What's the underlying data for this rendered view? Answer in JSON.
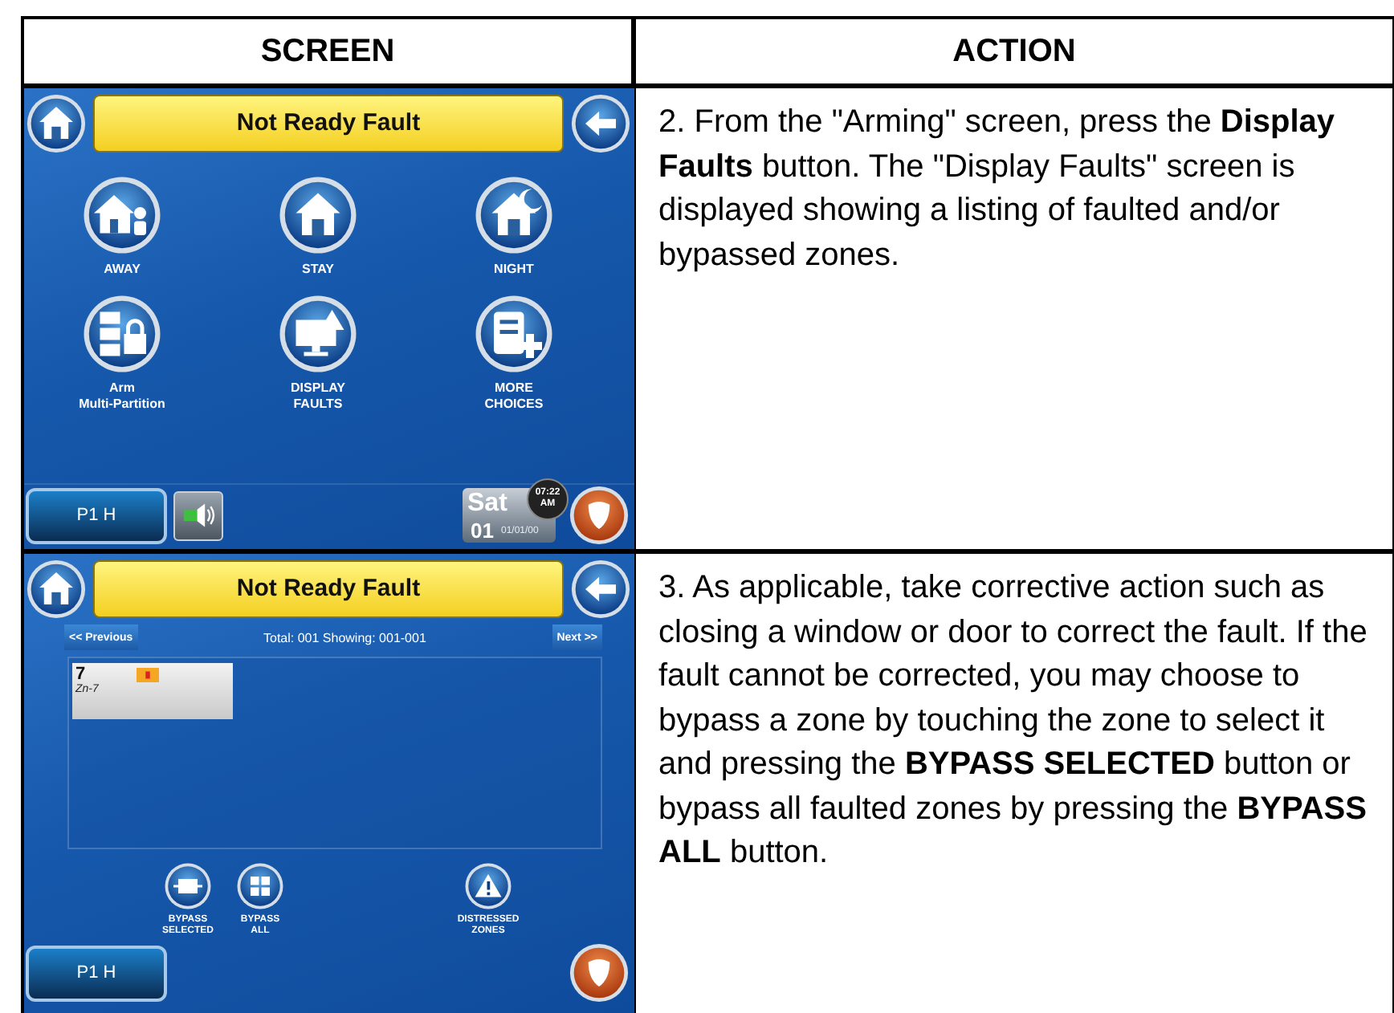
{
  "table": {
    "columns": [
      "SCREEN",
      "ACTION"
    ],
    "rows": [
      {
        "screen": {
          "kind": "arming",
          "title": "Not Ready Fault",
          "options": [
            {
              "label": "AWAY"
            },
            {
              "label": "STAY"
            },
            {
              "label": "NIGHT"
            },
            {
              "label": "Arm\nMulti-Partition"
            },
            {
              "label": "DISPLAY\nFAULTS"
            },
            {
              "label": "MORE\nCHOICES"
            }
          ],
          "partition_button": "P1 H",
          "date": {
            "day": "Sat",
            "date": "01",
            "full_date": "01/01/00",
            "time": "07:22",
            "ampm": "AM"
          }
        },
        "action": "2.  From the \"Arming\" screen, press the **Display Faults** button.  The \"Display Faults\" screen is displayed showing a listing of faulted and/or bypassed zones."
      },
      {
        "screen": {
          "kind": "faults",
          "title": "Not Ready Fault",
          "previous_button": "<< Previous",
          "summary": "Total: 001  Showing: 001-001",
          "next_button": "Next >>",
          "zones": [
            {
              "number": "7",
              "name": "Zn-7"
            }
          ],
          "actions": [
            {
              "label": "BYPASS\nSELECTED"
            },
            {
              "label": "BYPASS\nALL"
            },
            {
              "label": "DISTRESSED\nZONES"
            }
          ],
          "partition_button": "P1 H"
        },
        "action": "3.  As applicable, take corrective action such as closing a window or door to correct the fault. If the fault cannot be corrected, you may choose to bypass a zone by touching the zone to select it and pressing the **BYPASS SELECTED** button or bypass all faulted zones by pressing the **BYPASS ALL** button."
      }
    ]
  }
}
